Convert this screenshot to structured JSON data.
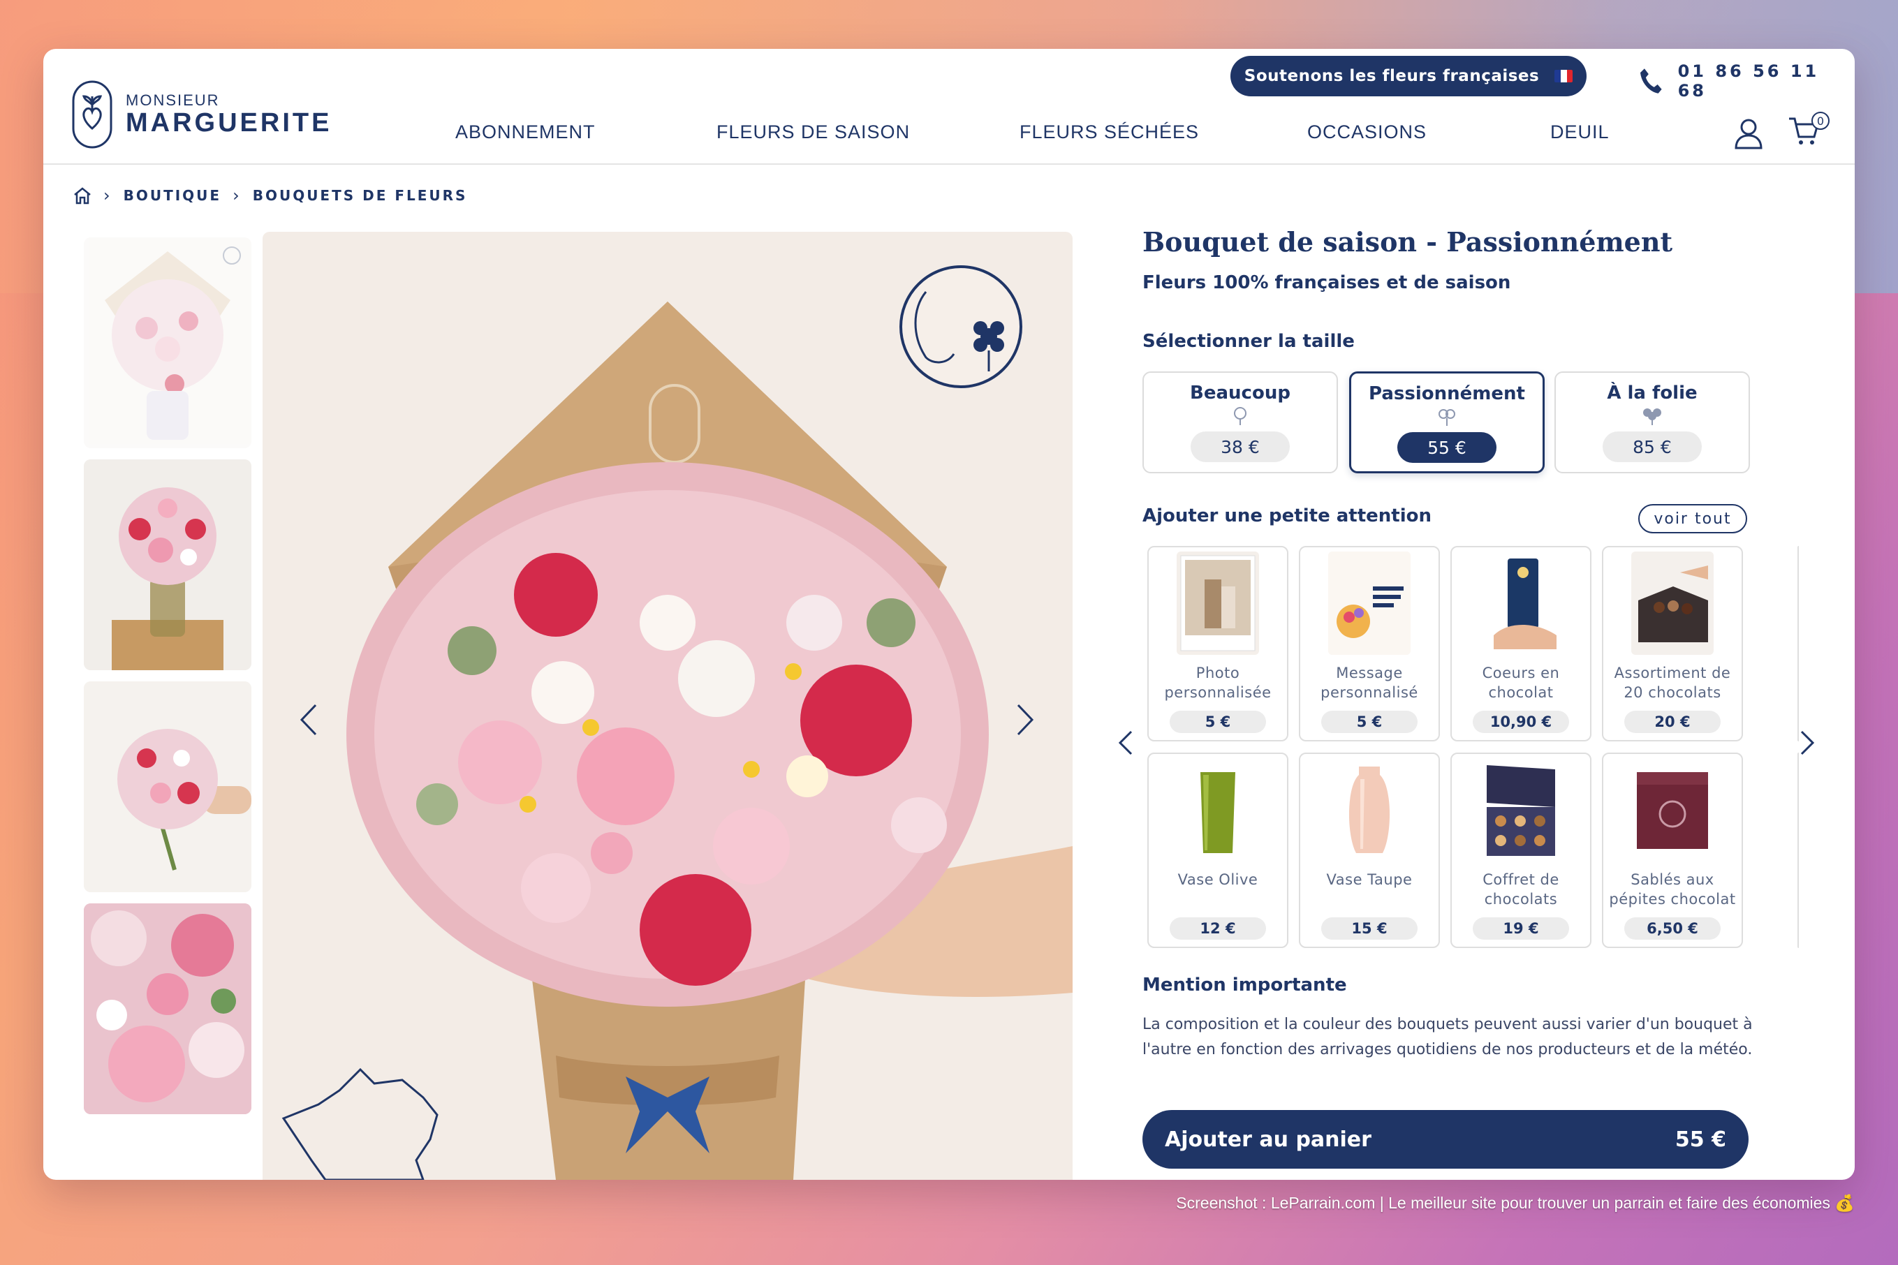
{
  "header": {
    "logo_small": "MONSIEUR",
    "logo_big": "MARGUERITE",
    "promo": "Soutenons les fleurs françaises",
    "phone": "01 86 56 11 68",
    "nav": [
      "ABONNEMENT",
      "FLEURS DE SAISON",
      "FLEURS SÉCHÉES",
      "OCCASIONS",
      "DEUIL"
    ],
    "cart_count": "0",
    "icons": [
      "phone-icon",
      "user-icon",
      "cart-icon",
      "home-icon"
    ],
    "flag_colors": [
      "#1f3a93",
      "#ffffff",
      "#e1262d"
    ]
  },
  "breadcrumb": [
    "BOUTIQUE",
    "BOUQUETS DE FLEURS"
  ],
  "product": {
    "title": "Bouquet de saison - Passionnément",
    "subtitle": "Fleurs 100% françaises et de saison",
    "size_label": "Sélectionner la taille",
    "sizes": [
      {
        "name": "Beaucoup",
        "price": "38 €",
        "selected": false
      },
      {
        "name": "Passionnément",
        "price": "55 €",
        "selected": true
      },
      {
        "name": "À la folie",
        "price": "85 €",
        "selected": false
      }
    ],
    "gift_label": "Ajouter une petite attention",
    "voir_tout": "voir tout",
    "gifts": [
      {
        "name": "Photo personnalisée",
        "price": "5 €"
      },
      {
        "name": "Message personnalisé",
        "price": "5 €"
      },
      {
        "name": "Coeurs en chocolat",
        "price": "10,90 €"
      },
      {
        "name": "Assortiment de 20 chocolats",
        "price": "20 €"
      },
      {
        "name": "Vase Olive",
        "price": "12 €"
      },
      {
        "name": "Vase Taupe",
        "price": "15 €"
      },
      {
        "name": "Coffret de chocolats",
        "price": "19 €"
      },
      {
        "name": "Sablés aux pépites chocolat",
        "price": "6,50 €"
      }
    ],
    "mention_label": "Mention importante",
    "mention_text": "La composition et la couleur des bouquets peuvent aussi varier d'un bouquet à l'autre en fonction des arrivages quotidiens de nos producteurs et de la météo.",
    "add_to_cart": "Ajouter au panier",
    "add_to_cart_price": "55 €"
  },
  "footer_note": "Screenshot : LeParrain.com | Le meilleur site pour trouver un parrain et faire des économies 💰",
  "colors": {
    "navy": "#1f3566",
    "background_image": "#f3ece6"
  }
}
